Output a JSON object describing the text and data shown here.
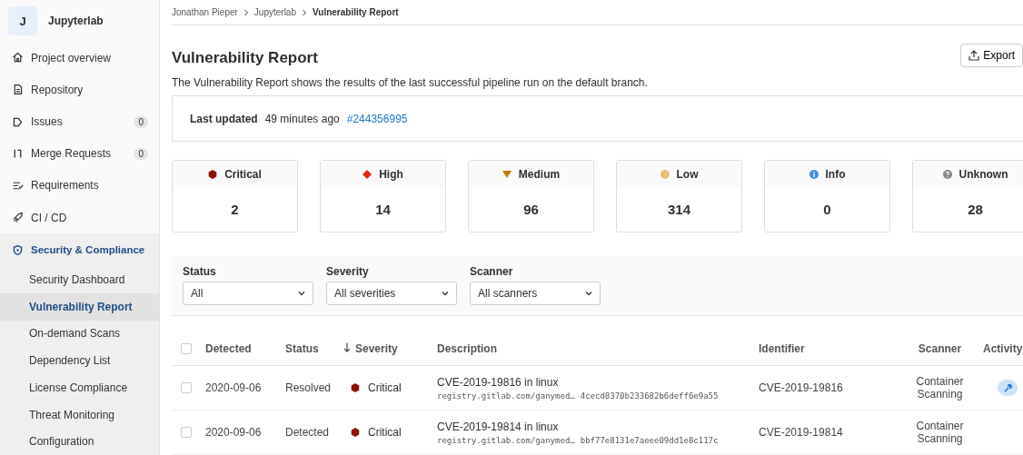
{
  "sidebar": {
    "project": {
      "avatar": "J",
      "name": "Jupyterlab"
    },
    "items": [
      {
        "label": "Project overview",
        "selected": false
      },
      {
        "label": "Repository",
        "selected": false
      },
      {
        "label": "Issues",
        "badge": "0",
        "selected": false
      },
      {
        "label": "Merge Requests",
        "badge": "0",
        "selected": false
      },
      {
        "label": "Requirements",
        "selected": false
      },
      {
        "label": "CI / CD",
        "selected": false
      },
      {
        "label": "Security & Compliance",
        "selected": true,
        "expanded": true,
        "children": [
          {
            "label": "Security Dashboard",
            "selected": false
          },
          {
            "label": "Vulnerability Report",
            "selected": true
          },
          {
            "label": "On-demand Scans",
            "selected": false
          },
          {
            "label": "Dependency List",
            "selected": false
          },
          {
            "label": "License Compliance",
            "selected": false
          },
          {
            "label": "Threat Monitoring",
            "selected": false
          },
          {
            "label": "Configuration",
            "selected": false
          }
        ]
      }
    ]
  },
  "breadcrumbs": [
    "Jonathan Pieper",
    "Jupyterlab",
    "Vulnerability Report"
  ],
  "title": "Vulnerability Report",
  "export_button": "Export",
  "description": "The Vulnerability Report shows the results of the last successful pipeline run on the default branch.",
  "last_updated": {
    "label": "Last updated",
    "time": "49 minutes ago",
    "pipeline": "#244356995"
  },
  "severity_cards": [
    {
      "label": "Critical",
      "count": "2",
      "kind": "hexagon",
      "color": "#8d1300"
    },
    {
      "label": "High",
      "count": "14",
      "kind": "diamond",
      "color": "#dd2b0e"
    },
    {
      "label": "Medium",
      "count": "96",
      "kind": "triangle",
      "color": "#c17d10"
    },
    {
      "label": "Low",
      "count": "314",
      "kind": "circle",
      "color": "#e9be74"
    },
    {
      "label": "Info",
      "count": "0",
      "kind": "info",
      "color": "#428fdc"
    },
    {
      "label": "Unknown",
      "count": "28",
      "kind": "question",
      "color": "#868686"
    }
  ],
  "filters": [
    {
      "label": "Status",
      "value": "All"
    },
    {
      "label": "Severity",
      "value": "All severities"
    },
    {
      "label": "Scanner",
      "value": "All scanners"
    }
  ],
  "table": {
    "select_all": {
      "checked": false
    },
    "columns": [
      "Detected",
      "Status",
      "Severity",
      "Description",
      "Identifier",
      "Scanner",
      "Activity"
    ],
    "rows": [
      {
        "checked": false,
        "detected": "2020-09-06",
        "status": "Resolved",
        "severity": "Critical",
        "color": "#8d1300",
        "title": "CVE-2019-19816 in linux",
        "location": "registry.gitlab.com/ganymed…",
        "hash": "4cecd8370b233682b6deff6e9a55",
        "identifier": "CVE-2019-19816",
        "scanner": "Container Scanning",
        "remediation": true
      },
      {
        "checked": false,
        "detected": "2020-09-06",
        "status": "Detected",
        "severity": "Critical",
        "color": "#8d1300",
        "title": "CVE-2019-19814 in linux",
        "location": "registry.gitlab.com/ganymed…",
        "hash": "bbf77e8131e7aeee09dd1e8c117c",
        "identifier": "CVE-2019-19814",
        "scanner": "Container Scanning",
        "remediation": false
      }
    ]
  }
}
